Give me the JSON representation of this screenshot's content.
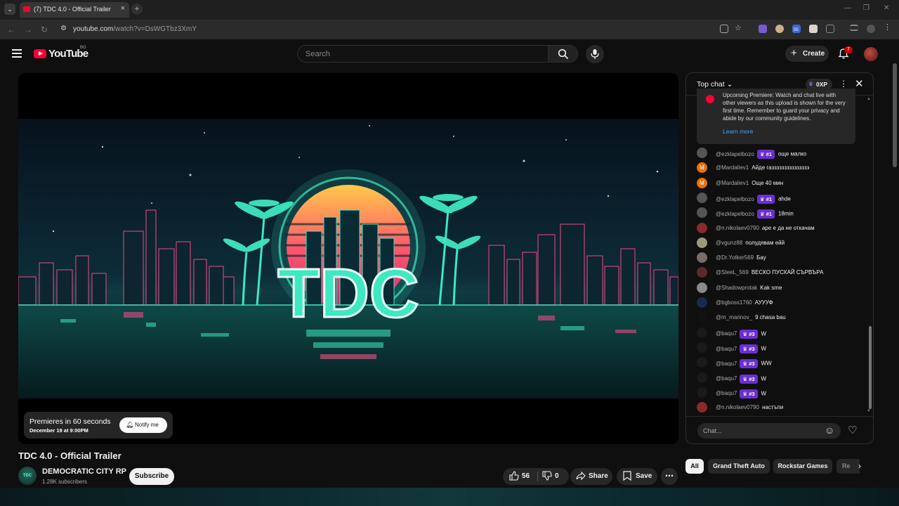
{
  "browser": {
    "tab_title": "(7) TDC 4.0 - Official Trailer - Yo",
    "url_domain": "youtube.com",
    "url_path": "/watch?v=DsWGTbz3XmY",
    "ext_badge": "55"
  },
  "header": {
    "logo_text": "YouTube",
    "country_code": "BG",
    "search_placeholder": "Search",
    "create_label": "Create",
    "notification_count": "7"
  },
  "player": {
    "thumbnail_text": "TDC",
    "premiere_title": "Premieres in 60 seconds",
    "premiere_date": "December 19 at 9:00PM",
    "notify_label": "Notify me"
  },
  "video": {
    "title": "TDC 4.0 - Official Trailer",
    "channel_avatar_text": "TDC",
    "channel_name": "DEMOCRATIC CITY RP",
    "subscribers": "1.28K subscribers",
    "subscribe_label": "Subscribe",
    "likes": "56",
    "dislikes": "0",
    "share_label": "Share",
    "save_label": "Save"
  },
  "chat": {
    "mode": "Top chat",
    "xp": "0XP",
    "notice": "Upcoming Premiere: Watch and chat live with other viewers as this upload is shown for the very first time. Remember to guard your privacy and abide by our community guidelines.",
    "learn_more": "Learn more",
    "input_placeholder": "Chat...",
    "messages": [
      {
        "user": "@ezklapelbozo",
        "badge": "#1",
        "text": "още малко",
        "avatar": "",
        "color": "#555555"
      },
      {
        "user": "@Mardaliev1",
        "badge": "",
        "text": "Айде газзззззззззззззз",
        "avatar": "M",
        "color": "#e8710a"
      },
      {
        "user": "@Mardaliev1",
        "badge": "",
        "text": "Още 40 мин",
        "avatar": "M",
        "color": "#e8710a"
      },
      {
        "user": "@ezklapelbozo",
        "badge": "#1",
        "text": "ahde",
        "avatar": "",
        "color": "#555555"
      },
      {
        "user": "@ezklapelbozo",
        "badge": "#1",
        "text": "18min",
        "avatar": "",
        "color": "#555555"
      },
      {
        "user": "@n.nikolaev0790",
        "badge": "",
        "text": "аре е да не откачам",
        "avatar": "",
        "color": "#8a2a2a"
      },
      {
        "user": "@vgunz88",
        "badge": "",
        "text": "полудявам ейй",
        "avatar": "",
        "color": "#9a9a7a"
      },
      {
        "user": "@Dr.Yotker569",
        "badge": "",
        "text": "Бау",
        "avatar": "",
        "color": "#7a6a6a"
      },
      {
        "user": "@SteeL_569",
        "badge": "",
        "text": "ВЕСКО ПУСКАЙ СЪРВЪРА",
        "avatar": "",
        "color": "#5a2a2a"
      },
      {
        "user": "@Shadowprotak",
        "badge": "",
        "text": "Kak sme",
        "avatar": "",
        "color": "#8a8a8a"
      },
      {
        "user": "@bgboss1760",
        "badge": "",
        "text": "АУУУФ",
        "avatar": "",
        "color": "#1a2a4a"
      },
      {
        "user": "@m_marinov_",
        "badge": "",
        "text": "9 chasa bau",
        "avatar": "",
        "color": "#111111"
      },
      {
        "user": "@baqu7",
        "badge": "#3",
        "text": "W",
        "avatar": "",
        "color": "#1a1a1a"
      },
      {
        "user": "@baqu7",
        "badge": "#3",
        "text": "W",
        "avatar": "",
        "color": "#1a1a1a"
      },
      {
        "user": "@baqu7",
        "badge": "#3",
        "text": "WW",
        "avatar": "",
        "color": "#1a1a1a"
      },
      {
        "user": "@baqu7",
        "badge": "#3",
        "text": "W",
        "avatar": "",
        "color": "#1a1a1a"
      },
      {
        "user": "@baqu7",
        "badge": "#3",
        "text": "W",
        "avatar": "",
        "color": "#1a1a1a"
      },
      {
        "user": "@n.nikolaev0790",
        "badge": "",
        "text": "настъпи",
        "avatar": "",
        "color": "#8a2a2a"
      }
    ]
  },
  "chips": [
    "All",
    "Grand Theft Auto",
    "Rockstar Games",
    "Re"
  ],
  "colors": {
    "accent": "#ff0033",
    "badge_purple": "#6a2fd0",
    "link": "#3ea6ff",
    "neon_teal": "#3ee8c0",
    "neon_pink": "#ff3a7a"
  }
}
